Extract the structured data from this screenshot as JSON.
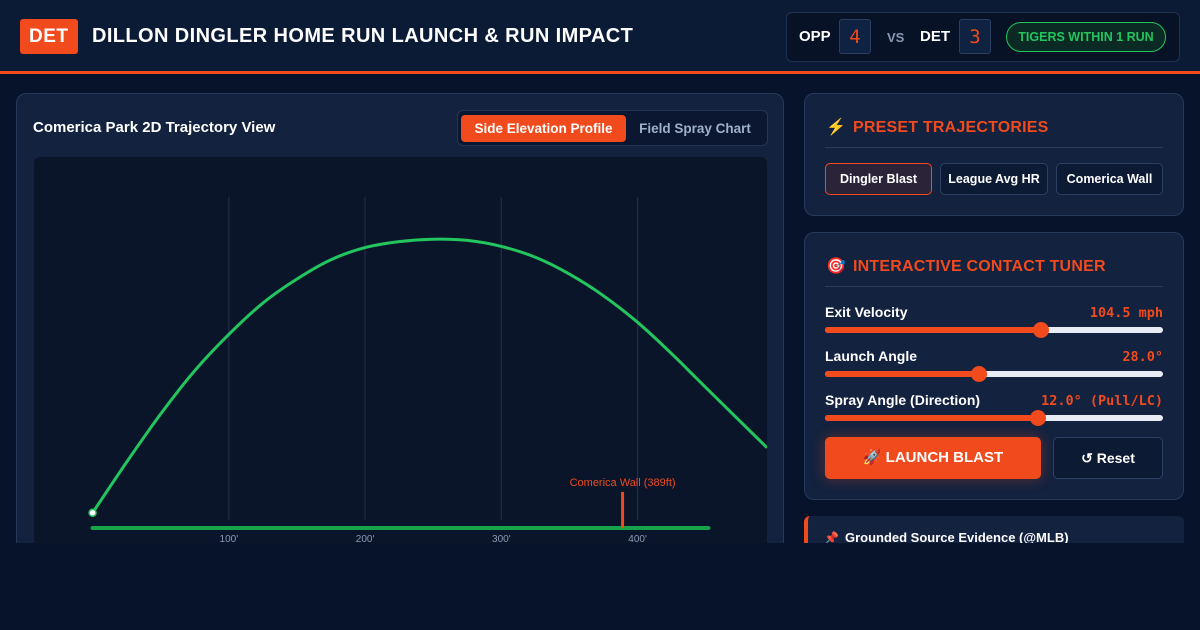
{
  "header": {
    "brand": "DET",
    "title": "DILLON DINGLER HOME RUN LAUNCH & RUN IMPACT"
  },
  "scoreboard": {
    "away_team": "OPP",
    "away_score": "4",
    "vs": "VS",
    "home_team": "DET",
    "home_score": "3",
    "status_badge": "TIGERS WITHIN 1 RUN"
  },
  "trajectory_view": {
    "title": "Comerica Park 2D Trajectory View",
    "tabs": [
      {
        "label": "Side Elevation Profile",
        "active": true
      },
      {
        "label": "Field Spray Chart",
        "active": false
      }
    ]
  },
  "chart_data": {
    "type": "line",
    "title": "",
    "xlabel": "",
    "ylabel": "",
    "x_ticks": [
      "100'",
      "200'",
      "300'",
      "400'"
    ],
    "x_tick_values": [
      100,
      200,
      300,
      400
    ],
    "xlim": [
      -43,
      495
    ],
    "ylim": [
      0,
      134
    ],
    "grid": true,
    "series": [
      {
        "x": [
          0,
          25,
          50,
          75,
          100,
          125,
          150,
          175,
          200,
          225,
          250,
          275,
          300,
          325,
          350,
          375,
          400,
          425,
          450,
          495
        ],
        "y": [
          3,
          24,
          44,
          62,
          77,
          90,
          100,
          108,
          113,
          115.5,
          116.5,
          116,
          113.5,
          109,
          102,
          93,
          82,
          69,
          55,
          30
        ]
      }
    ],
    "wall": {
      "label": "Comerica Wall (389ft)",
      "distance": 389,
      "height": 10
    },
    "ground_line_end": 452
  },
  "presets": {
    "title": "PRESET TRAJECTORIES",
    "icon": "lightning-icon",
    "buttons": [
      {
        "label": "Dingler Blast",
        "active": true
      },
      {
        "label": "League Avg HR",
        "active": false
      },
      {
        "label": "Comerica Wall",
        "active": false
      }
    ]
  },
  "tuner": {
    "title": "INTERACTIVE CONTACT TUNER",
    "icon": "target-icon",
    "sliders": [
      {
        "label": "Exit Velocity",
        "value_text": "104.5 mph",
        "fraction": 0.64
      },
      {
        "label": "Launch Angle",
        "value_text": "28.0°",
        "fraction": 0.455
      },
      {
        "label": "Spray Angle (Direction)",
        "value_text": "12.0° (Pull/LC)",
        "fraction": 0.63
      }
    ],
    "launch_label": "🚀 LAUNCH BLAST",
    "reset_label": "↺ Reset"
  },
  "evidence": {
    "title": "Grounded Source Evidence (@MLB)"
  },
  "colors": {
    "accent": "#f04a1d",
    "trajectory": "#22c55e",
    "ground": "#16a34a",
    "background": "#07132a"
  }
}
